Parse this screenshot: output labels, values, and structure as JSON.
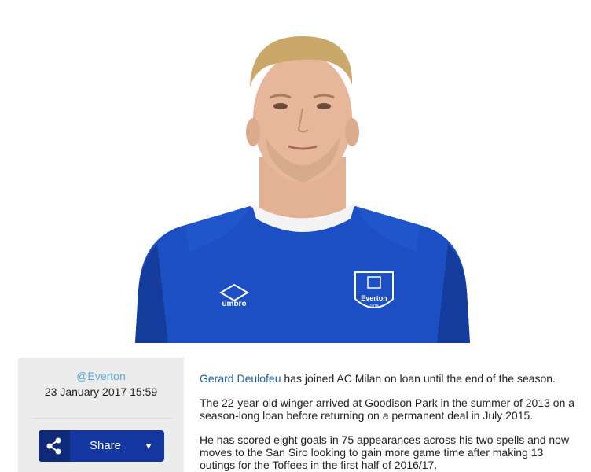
{
  "hero": {
    "kit_brand": "umbro",
    "badge_text": "Everton",
    "badge_year": "1878",
    "badge_motto": "NIL SATIS NISI OPTIMUM",
    "colors": {
      "shirt": "#1c4fc4",
      "shirt_dark": "#143c9c",
      "collar": "#f4f4f4",
      "hair": "#c9a869",
      "skin": "#e6b79a"
    }
  },
  "sidebar": {
    "handle": "@Everton",
    "timestamp": "23 January 2017 15:59",
    "share_label": "Share",
    "share_caret": "▼",
    "colors": {
      "background": "#ececec",
      "handle": "#5aa9d8",
      "share_button": "#1436a0",
      "share_icon_bg": "#0e2a78"
    }
  },
  "article": {
    "p1_link": "Gerard Deulofeu",
    "p1_rest": " has joined AC Milan on loan until the end of the season.",
    "p2": "The 22-year-old winger arrived at Goodison Park in the summer of 2013 on a season-long loan before returning on a permanent deal in July 2015.",
    "p3": "He has scored eight goals in 75 appearances across his two spells and now moves to the San Siro looking to gain more game time after making 13 outings for the Toffees in the first half of 2016/17.",
    "link_color": "#1f5fa8"
  }
}
